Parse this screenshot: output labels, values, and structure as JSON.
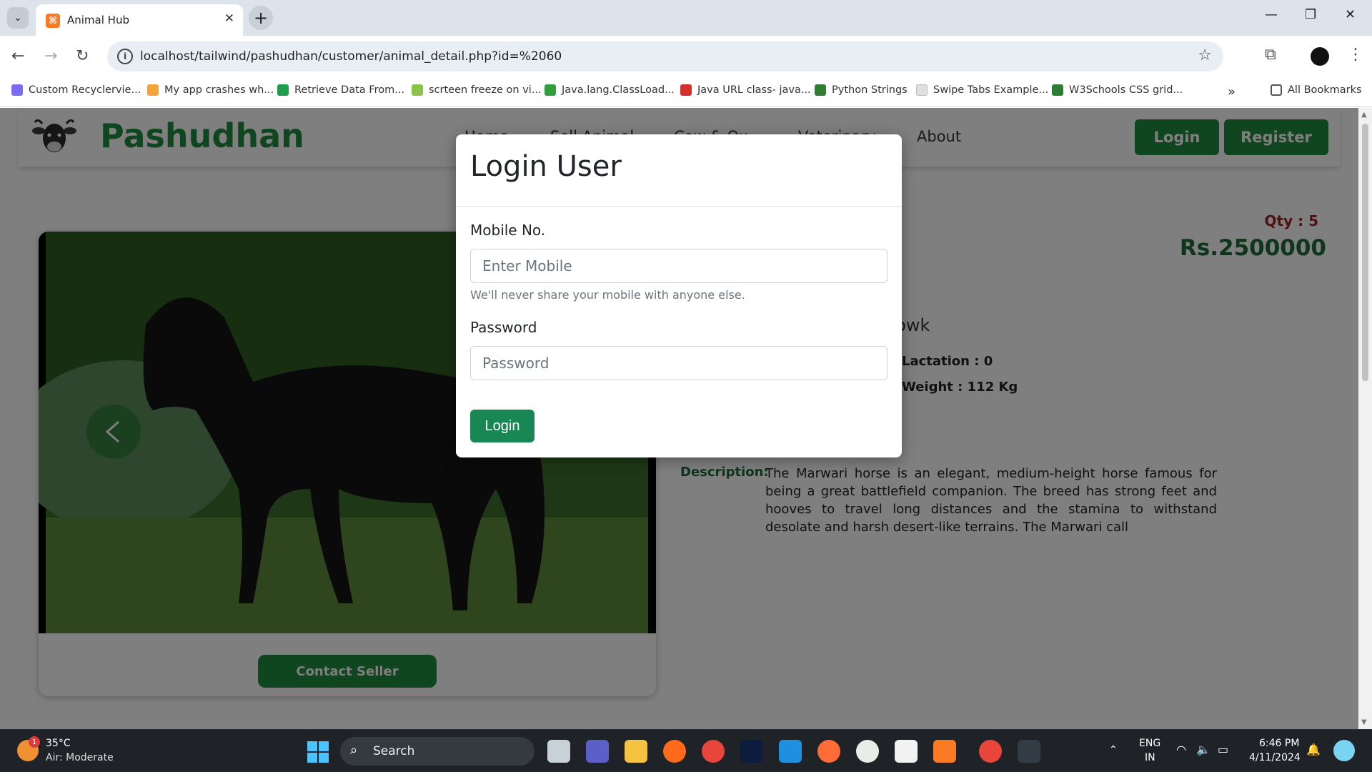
{
  "browser": {
    "tab_title": "Animal Hub",
    "url": "localhost/tailwind/pashudhan/customer/animal_detail.php?id=%2060",
    "bookmarks": [
      {
        "label": "Custom Recyclervie...",
        "color": "#7c6cf0"
      },
      {
        "label": "My app crashes wh...",
        "color": "#f2a33a"
      },
      {
        "label": "Retrieve Data From...",
        "color": "#1e9e4a"
      },
      {
        "label": "scrteen freeze on vi...",
        "color": "#8bc34a"
      },
      {
        "label": "Java.lang.ClassLoad...",
        "color": "#2e9e3e"
      },
      {
        "label": "Java URL class- java...",
        "color": "#d32f2f"
      },
      {
        "label": "Python Strings",
        "color": "#2e7d32"
      },
      {
        "label": "Swipe Tabs Example...",
        "color": "#e0e0e0"
      },
      {
        "label": "W3Schools CSS grid...",
        "color": "#2e7d32"
      }
    ],
    "all_bookmarks": "All Bookmarks"
  },
  "site": {
    "brand": "Pashudhan",
    "nav": [
      "Home",
      "Sell Animal",
      "Cow & Ox",
      "Veterinary",
      "About"
    ],
    "login_label": "Login",
    "register_label": "Register",
    "accent": "#1e8a3e"
  },
  "detail": {
    "qty_label": "Qty :",
    "qty_value": "5",
    "price": "Rs.2500000",
    "name_fragment": "nowk",
    "lactation_label": "Lactation :",
    "lactation_value": "0",
    "weight_label": "Weight :",
    "weight_value": "112 Kg",
    "description_label": "Description:",
    "description": "The Marwari horse is an elegant, medium-height horse famous for being a great battlefield companion. The breed has strong feet and hooves to travel long distances and the stamina to withstand desolate and harsh desert-like terrains. The Marwari call",
    "contact_label": "Contact Seller"
  },
  "modal": {
    "title": "Login User",
    "mobile_label": "Mobile No.",
    "mobile_placeholder": "Enter Mobile",
    "mobile_help": "We'll never share your mobile with anyone else.",
    "password_label": "Password",
    "password_placeholder": "Password",
    "submit_label": "Login"
  },
  "taskbar": {
    "weather_temp": "35°C",
    "weather_desc": "Air: Moderate",
    "weather_badge": "1",
    "search_label": "Search",
    "lang1": "ENG",
    "lang2": "IN",
    "time": "6:46 PM",
    "date": "4/11/2024"
  }
}
